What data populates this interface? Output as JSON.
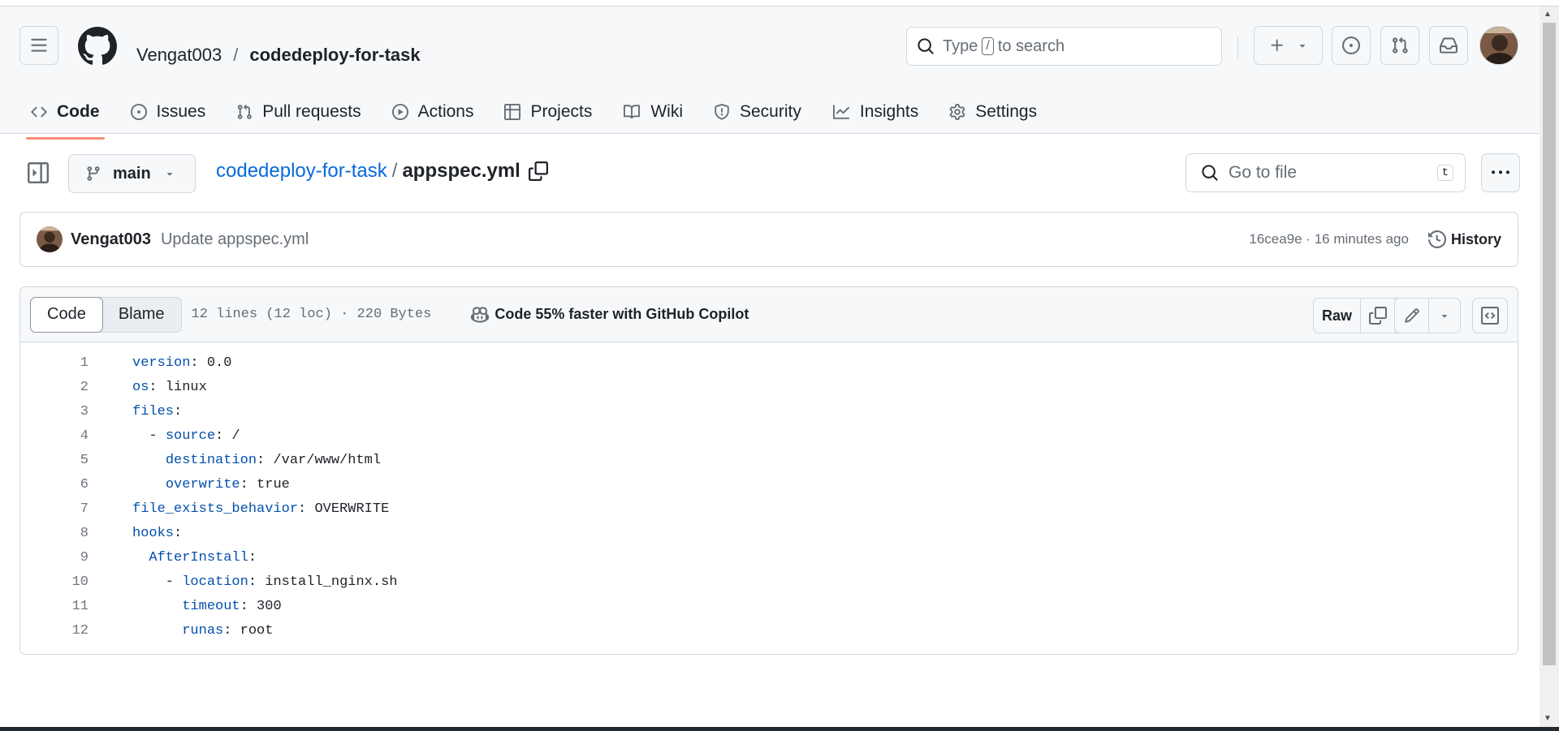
{
  "header": {
    "owner": "Vengat003",
    "separator": "/",
    "repo": "codedeploy-for-task",
    "search": {
      "prefix": "Type",
      "key": "/",
      "suffix": "to search"
    }
  },
  "tabs": [
    {
      "label": "Code",
      "icon": "code-icon",
      "active": true
    },
    {
      "label": "Issues",
      "icon": "issue-icon"
    },
    {
      "label": "Pull requests",
      "icon": "pull-request-icon"
    },
    {
      "label": "Actions",
      "icon": "play-icon"
    },
    {
      "label": "Projects",
      "icon": "table-icon"
    },
    {
      "label": "Wiki",
      "icon": "book-icon"
    },
    {
      "label": "Security",
      "icon": "shield-icon"
    },
    {
      "label": "Insights",
      "icon": "graph-icon"
    },
    {
      "label": "Settings",
      "icon": "gear-icon"
    }
  ],
  "branch": "main",
  "breadcrumb": {
    "repo": "codedeploy-for-task",
    "sep": "/",
    "file": "appspec.yml"
  },
  "goto": {
    "placeholder": "Go to file",
    "key": "t"
  },
  "commit": {
    "author": "Vengat003",
    "message": "Update appspec.yml",
    "meta": "16cea9e · 16 minutes ago",
    "history_label": "History"
  },
  "file": {
    "view_code": "Code",
    "view_blame": "Blame",
    "info": "12 lines (12 loc) · 220 Bytes",
    "copilot": "Code 55% faster with GitHub Copilot",
    "raw_label": "Raw"
  },
  "code_lines": [
    {
      "n": "1",
      "indent": "",
      "key": "version",
      "value": " 0.0"
    },
    {
      "n": "2",
      "indent": "",
      "key": "os",
      "value": " linux"
    },
    {
      "n": "3",
      "indent": "",
      "key": "files",
      "value": ""
    },
    {
      "n": "4",
      "indent": "  - ",
      "key": "source",
      "value": " /"
    },
    {
      "n": "5",
      "indent": "    ",
      "key": "destination",
      "value": " /var/www/html"
    },
    {
      "n": "6",
      "indent": "    ",
      "key": "overwrite",
      "value": " true"
    },
    {
      "n": "7",
      "indent": "",
      "key": "file_exists_behavior",
      "value": " OVERWRITE"
    },
    {
      "n": "8",
      "indent": "",
      "key": "hooks",
      "value": ""
    },
    {
      "n": "9",
      "indent": "  ",
      "key": "AfterInstall",
      "value": ""
    },
    {
      "n": "10",
      "indent": "    - ",
      "key": "location",
      "value": " install_nginx.sh"
    },
    {
      "n": "11",
      "indent": "      ",
      "key": "timeout",
      "value": " 300"
    },
    {
      "n": "12",
      "indent": "      ",
      "key": "runas",
      "value": " root"
    }
  ]
}
